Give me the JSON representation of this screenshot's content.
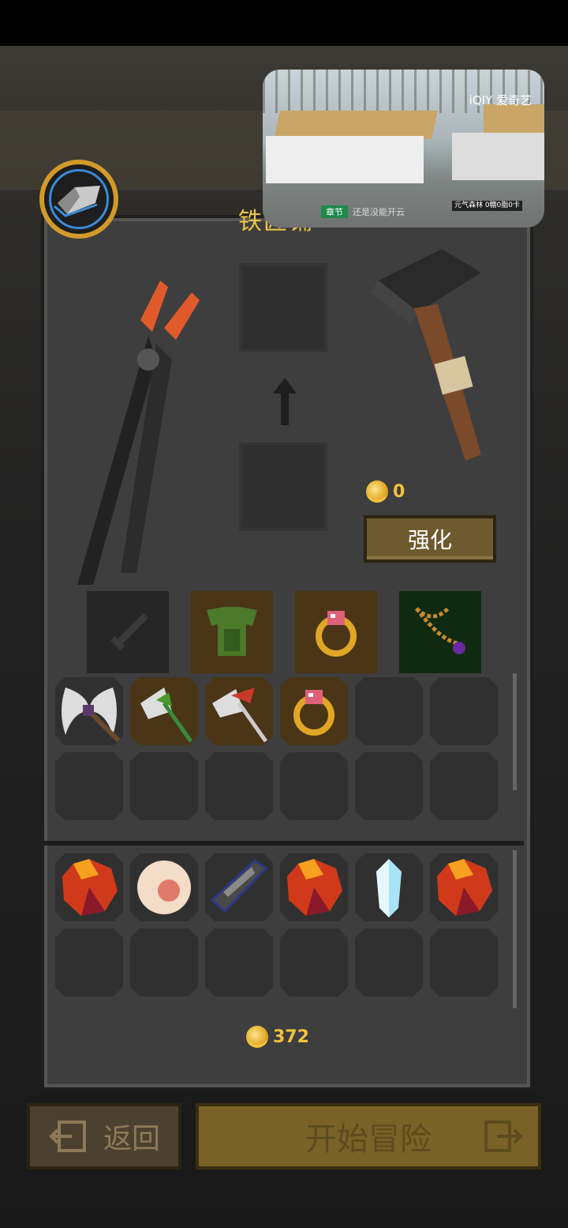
{
  "video_overlay": {
    "watermark": "iQIY 爱奇艺",
    "subtitle_tag": "章节",
    "subtitle_text": "还是没能开云",
    "corner_text": "元气森林 0糖0脂0卡"
  },
  "forge": {
    "title": "铁匠铺",
    "tool_left": "pliers-icon",
    "tool_right": "hammer-icon",
    "upgrade_cost": "0",
    "upgrade_button": "强化"
  },
  "equipped": [
    "sword-silhouette-icon",
    "green-armor-icon",
    "ruby-ring-icon",
    "amulet-icon"
  ],
  "inventory_gear": [
    "purple-battle-axe-icon",
    "green-halberd-icon",
    "red-halberd-icon",
    "ruby-ring-icon"
  ],
  "inventory_materials": [
    "ruby-gem-icon",
    "pearl-orb-icon",
    "dark-crystal-icon",
    "ruby-gem-icon",
    "ice-crystal-icon",
    "ruby-gem-icon"
  ],
  "gold": "372",
  "buttons": {
    "back": "返回",
    "start": "开始冒险"
  },
  "colors": {
    "accent_gold": "#f1c23e",
    "button_brown": "#6e5a2f",
    "slot_owned": "#4a3516"
  }
}
